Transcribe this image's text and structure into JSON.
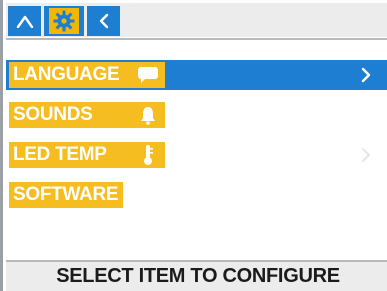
{
  "colors": {
    "accent_blue": "#1e7fd2",
    "item_yellow": "#f5bd1f",
    "bar_gray": "#ececec"
  },
  "toolbar": {
    "home_icon": "home-icon",
    "settings_icon": "gear-icon",
    "back_icon": "chevron-left-icon"
  },
  "menu": {
    "items": [
      {
        "label": "LANGUAGE",
        "icon": "speech-bubble-icon",
        "selected": true
      },
      {
        "label": "SOUNDS",
        "icon": "bell-icon",
        "selected": false
      },
      {
        "label": "LED TEMP",
        "icon": "thermometer-icon",
        "selected": false
      },
      {
        "label": "SOFTWARE",
        "icon": "",
        "selected": false
      }
    ]
  },
  "footer": {
    "status_text": "SELECT ITEM TO CONFIGURE"
  }
}
